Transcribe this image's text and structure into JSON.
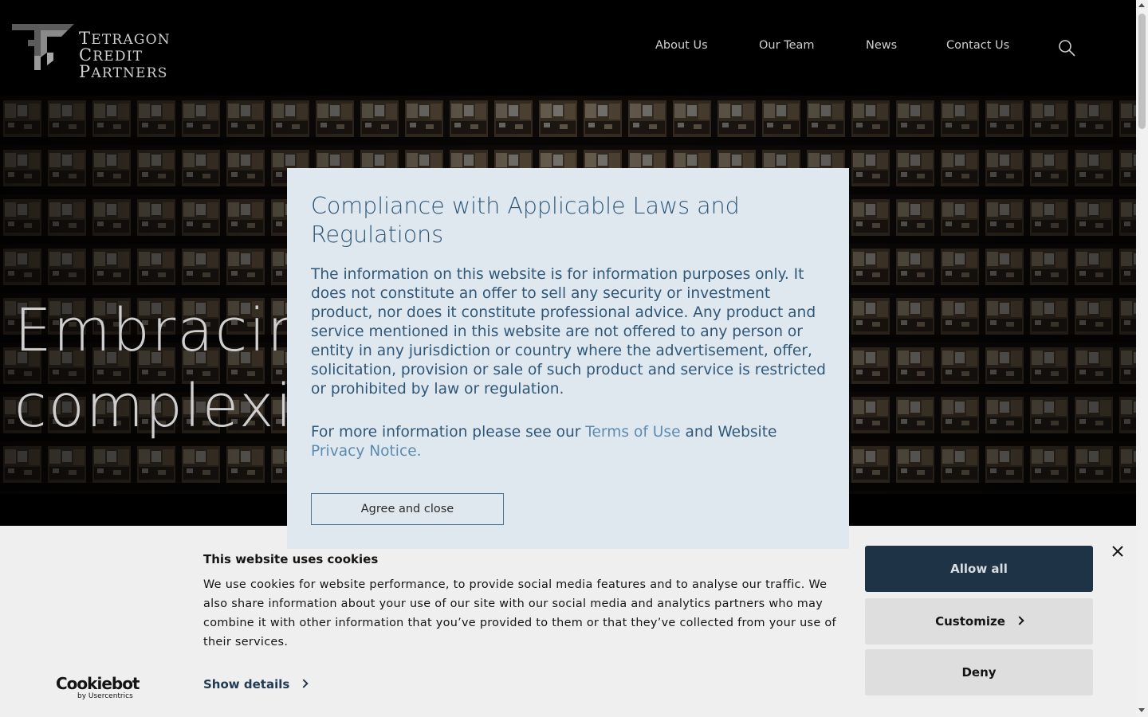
{
  "header": {
    "logo_line1_initial1": "T",
    "logo_line1_rest1": "etragon",
    "logo_line1_initial2": "C",
    "logo_line1_rest2": "redit",
    "logo_line2_initial": "P",
    "logo_line2_rest": "artners",
    "nav": [
      {
        "label": "About Us"
      },
      {
        "label": "Our Team"
      },
      {
        "label": "News"
      },
      {
        "label": "Contact Us"
      }
    ],
    "search_icon": "search-icon"
  },
  "hero": {
    "line1": "Embracing",
    "line2": "complexity"
  },
  "modal": {
    "title": "Compliance with Applicable Laws and Regulations",
    "body": "The information on this website is for information purposes only. It does not constitute an offer to sell any security or investment product, nor does it constitute professional advice. Any product and service mentioned in this website are not offered to any person or entity in any jurisdiction or country where the advertisement, offer, solicitation, provision or sale of such product and service is restricted or prohibited by law or regulation.",
    "more_prefix": "For more information please see our ",
    "terms_link": "Terms of Use",
    "more_middle": " and Website ",
    "privacy_link": "Privacy Notice",
    "more_suffix": ".",
    "agree_label": "Agree and close"
  },
  "cookie": {
    "brand": "Cookiebot",
    "brand_sub": "by Usercentrics",
    "title": "This website uses cookies",
    "text": "We use cookies for website performance, to provide social media features and to analyse our traffic. We also share information about your use of our site with our social media and analytics partners who may combine it with other information that you’ve provided to them or that they’ve collected from your use of their services.",
    "show_details": "Show details",
    "allow_all": "Allow all",
    "customize": "Customize",
    "deny": "Deny",
    "close_icon": "close-icon"
  },
  "colors": {
    "modal_bg": "#e0e8ef",
    "modal_text": "#2f5878",
    "link": "#5c8bb0",
    "allow_btn": "#1f3347",
    "cookie_bg": "#efefef"
  }
}
